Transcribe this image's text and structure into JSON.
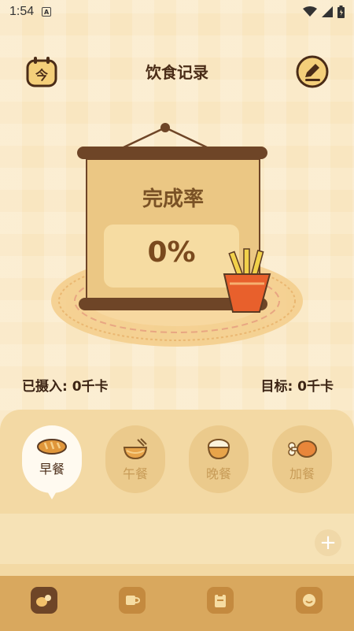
{
  "status_bar": {
    "time": "1:54",
    "notification_letter": "A",
    "icons": [
      "wifi-icon",
      "signal-icon",
      "battery-icon"
    ]
  },
  "header": {
    "title": "饮食记录",
    "left_button_icon": "calendar-today-icon",
    "left_button_glyph": "今",
    "right_button_icon": "edit-icon"
  },
  "scroll": {
    "label": "完成率",
    "percent_text": "0%",
    "completion_fraction": 0
  },
  "stats": {
    "intake": "已摄入: 0千卡",
    "target": "目标: 0千卡"
  },
  "meals": {
    "selected": "早餐",
    "tabs": [
      {
        "label": "早餐",
        "icon": "bread-icon"
      },
      {
        "label": "午餐",
        "icon": "noodle-bowl-icon"
      },
      {
        "label": "晚餐",
        "icon": "rice-bowl-icon"
      },
      {
        "label": "加餐",
        "icon": "chicken-leg-icon"
      }
    ]
  },
  "add_button": {
    "label": "+",
    "icon": "plus-icon"
  },
  "bottom_nav": {
    "items": [
      {
        "icon": "food-record-icon",
        "active": true
      },
      {
        "icon": "cup-icon",
        "active": false
      },
      {
        "icon": "clipboard-icon",
        "active": false
      },
      {
        "icon": "profile-face-icon",
        "active": false
      }
    ]
  },
  "colors": {
    "background": "#f9e6c0",
    "panel": "#f3d9a4",
    "dark_brown": "#6e4527",
    "nav_bar": "#d9a85e"
  }
}
